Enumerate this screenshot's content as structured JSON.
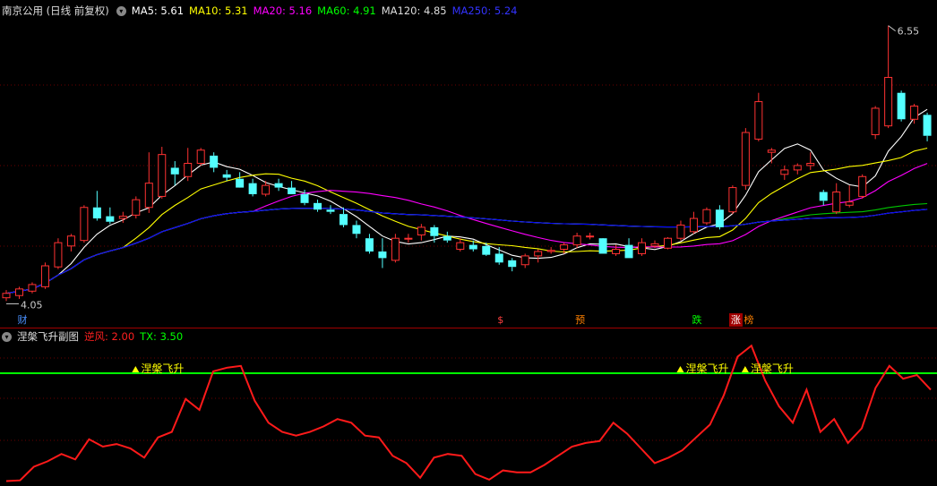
{
  "main_header": {
    "title": "南京公用 (日线 前复权)",
    "ma": [
      {
        "label": "MA5: 5.61",
        "color": "#ffffff"
      },
      {
        "label": "MA10: 5.31",
        "color": "#ffff00"
      },
      {
        "label": "MA20: 5.16",
        "color": "#ff00ff"
      },
      {
        "label": "MA60: 4.91",
        "color": "#00ff00"
      },
      {
        "label": "MA120: 4.85",
        "color": "#dddddd"
      },
      {
        "label": "MA250: 5.24",
        "color": "#0000ff"
      }
    ]
  },
  "sub_header": {
    "title": "涅槃飞升副图",
    "items": [
      {
        "label": "逆风: 2.00",
        "color": "#ff2020"
      },
      {
        "label": "TX: 3.50",
        "color": "#00ff00"
      }
    ]
  },
  "markers": [
    {
      "text": "财",
      "color": "#4a90ff",
      "bg": "",
      "index": 1
    },
    {
      "text": "$",
      "color": "#ff4040",
      "bg": "",
      "index": 38
    },
    {
      "text": "预",
      "color": "#ff8000",
      "bg": "",
      "index": 44
    },
    {
      "text": "跌",
      "color": "#00ff00",
      "bg": "",
      "index": 53
    },
    {
      "text": "涨",
      "color": "#ffffff",
      "bg": "#a00000",
      "index": 56
    },
    {
      "text": "榜",
      "color": "#ff8000",
      "bg": "",
      "index": 57
    }
  ],
  "chart_data": {
    "type": "candlestick",
    "high_label": "6.55",
    "low_label": "4.05",
    "ylim": [
      3.98,
      6.62
    ],
    "candles": [
      [
        4.08,
        4.15,
        4.05,
        4.12
      ],
      [
        4.1,
        4.18,
        4.07,
        4.16
      ],
      [
        4.14,
        4.22,
        4.12,
        4.2
      ],
      [
        4.18,
        4.4,
        4.16,
        4.37
      ],
      [
        4.36,
        4.62,
        4.34,
        4.58
      ],
      [
        4.55,
        4.66,
        4.5,
        4.64
      ],
      [
        4.6,
        4.92,
        4.58,
        4.9
      ],
      [
        4.9,
        5.05,
        4.78,
        4.8
      ],
      [
        4.82,
        4.9,
        4.75,
        4.77
      ],
      [
        4.8,
        4.86,
        4.76,
        4.82
      ],
      [
        4.83,
        5.0,
        4.8,
        4.97
      ],
      [
        4.9,
        5.4,
        4.85,
        5.12
      ],
      [
        5.0,
        5.45,
        4.98,
        5.38
      ],
      [
        5.26,
        5.32,
        5.1,
        5.2
      ],
      [
        5.18,
        5.44,
        5.14,
        5.3
      ],
      [
        5.3,
        5.44,
        5.28,
        5.42
      ],
      [
        5.37,
        5.4,
        5.22,
        5.26
      ],
      [
        5.2,
        5.24,
        5.14,
        5.17
      ],
      [
        5.16,
        5.22,
        5.1,
        5.08
      ],
      [
        5.12,
        5.16,
        5.0,
        5.02
      ],
      [
        5.02,
        5.14,
        5.0,
        5.1
      ],
      [
        5.12,
        5.16,
        5.05,
        5.08
      ],
      [
        5.08,
        5.14,
        5.02,
        5.02
      ],
      [
        5.02,
        5.06,
        4.92,
        4.94
      ],
      [
        4.94,
        4.97,
        4.86,
        4.88
      ],
      [
        4.88,
        4.92,
        4.84,
        4.86
      ],
      [
        4.84,
        4.9,
        4.72,
        4.74
      ],
      [
        4.74,
        4.78,
        4.62,
        4.66
      ],
      [
        4.62,
        4.66,
        4.48,
        4.5
      ],
      [
        4.5,
        4.62,
        4.35,
        4.44
      ],
      [
        4.42,
        4.66,
        4.4,
        4.62
      ],
      [
        4.62,
        4.66,
        4.58,
        4.62
      ],
      [
        4.65,
        4.75,
        4.6,
        4.72
      ],
      [
        4.72,
        4.74,
        4.58,
        4.64
      ],
      [
        4.64,
        4.68,
        4.58,
        4.6
      ],
      [
        4.52,
        4.62,
        4.5,
        4.58
      ],
      [
        4.56,
        4.6,
        4.5,
        4.52
      ],
      [
        4.55,
        4.58,
        4.46,
        4.47
      ],
      [
        4.48,
        4.54,
        4.38,
        4.4
      ],
      [
        4.42,
        4.44,
        4.32,
        4.36
      ],
      [
        4.38,
        4.48,
        4.35,
        4.46
      ],
      [
        4.46,
        4.52,
        4.4,
        4.5
      ],
      [
        4.5,
        4.54,
        4.48,
        4.51
      ],
      [
        4.52,
        4.58,
        4.48,
        4.56
      ],
      [
        4.56,
        4.67,
        4.53,
        4.64
      ],
      [
        4.64,
        4.67,
        4.61,
        4.64
      ],
      [
        4.62,
        4.6,
        4.48,
        4.48
      ],
      [
        4.48,
        4.56,
        4.46,
        4.52
      ],
      [
        4.56,
        4.62,
        4.44,
        4.44
      ],
      [
        4.48,
        4.62,
        4.46,
        4.58
      ],
      [
        4.55,
        4.6,
        4.53,
        4.57
      ],
      [
        4.53,
        4.63,
        4.52,
        4.62
      ],
      [
        4.62,
        4.78,
        4.6,
        4.74
      ],
      [
        4.68,
        4.86,
        4.66,
        4.8
      ],
      [
        4.76,
        4.9,
        4.74,
        4.88
      ],
      [
        4.88,
        4.92,
        4.7,
        4.72
      ],
      [
        4.86,
        5.1,
        4.84,
        5.08
      ],
      [
        5.1,
        5.62,
        5.06,
        5.58
      ],
      [
        5.52,
        5.94,
        5.5,
        5.86
      ],
      [
        5.4,
        5.44,
        5.3,
        5.42
      ],
      [
        5.2,
        5.28,
        5.15,
        5.24
      ],
      [
        5.24,
        5.3,
        5.2,
        5.28
      ],
      [
        5.28,
        5.4,
        5.24,
        5.3
      ],
      [
        5.04,
        5.06,
        4.92,
        4.96
      ],
      [
        4.86,
        5.12,
        4.84,
        5.04
      ],
      [
        4.92,
        5.1,
        4.9,
        4.95
      ],
      [
        5.0,
        5.2,
        4.98,
        5.18
      ],
      [
        5.56,
        5.82,
        5.52,
        5.8
      ],
      [
        5.64,
        6.55,
        5.62,
        6.08
      ],
      [
        5.94,
        5.96,
        5.68,
        5.7
      ],
      [
        5.7,
        5.84,
        5.66,
        5.82
      ],
      [
        5.74,
        5.76,
        5.5,
        5.55
      ]
    ],
    "moving_averages": [
      {
        "name": "MA5",
        "color": "#ffffff"
      },
      {
        "name": "MA10",
        "color": "#ffff00"
      },
      {
        "name": "MA20",
        "color": "#ff00ff"
      },
      {
        "name": "MA60",
        "color": "#00c800"
      },
      {
        "name": "MA120",
        "color": "#dcdcdc"
      },
      {
        "name": "MA250",
        "color": "#0000ff"
      }
    ],
    "sub": {
      "ylim": [
        0.5,
        4.45
      ],
      "threshold": 3.5,
      "signal_label": "涅槃飞升",
      "signal_indices": [
        9,
        51,
        56
      ],
      "line": [
        0.56,
        0.58,
        0.95,
        1.1,
        1.3,
        1.15,
        1.7,
        1.5,
        1.57,
        1.45,
        1.2,
        1.75,
        1.9,
        2.8,
        2.5,
        3.55,
        3.65,
        3.7,
        2.75,
        2.15,
        1.9,
        1.8,
        1.9,
        2.05,
        2.25,
        2.15,
        1.8,
        1.75,
        1.25,
        1.05,
        0.65,
        1.2,
        1.3,
        1.25,
        0.75,
        0.6,
        0.85,
        0.8,
        0.8,
        1.0,
        1.25,
        1.5,
        1.6,
        1.65,
        2.15,
        1.85,
        1.45,
        1.05,
        1.2,
        1.4,
        1.75,
        2.1,
        2.9,
        3.95,
        4.25,
        3.3,
        2.6,
        2.15,
        3.05,
        1.9,
        2.25,
        1.6,
        2.0,
        3.1,
        3.7,
        3.35,
        3.45,
        3.05
      ]
    }
  }
}
